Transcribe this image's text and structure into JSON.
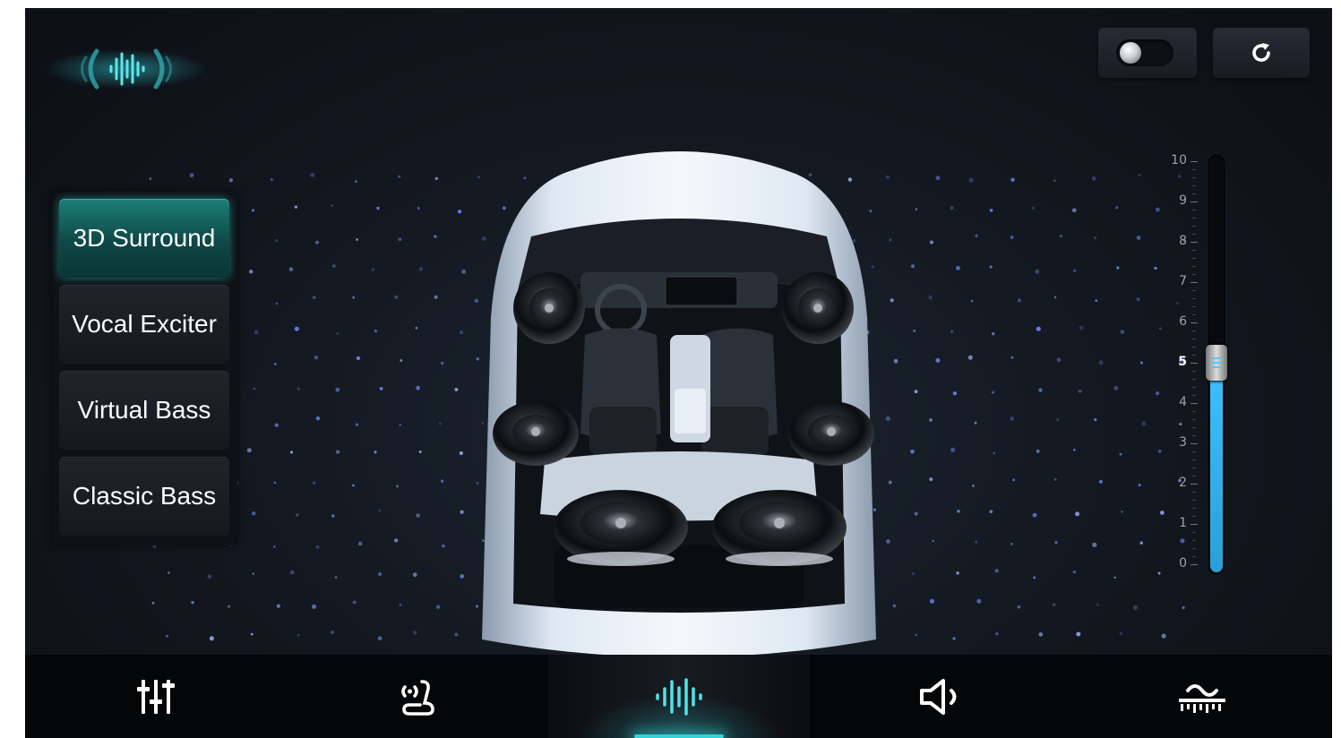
{
  "header": {
    "logo_icon": "sound-wave-logo-icon",
    "toggle": {
      "icon": "toggle-switch-icon",
      "state": "off"
    },
    "reset": {
      "icon": "refresh-icon"
    }
  },
  "sound_modes": {
    "items": [
      {
        "label": "3D Surround",
        "active": true
      },
      {
        "label": "Vocal Exciter",
        "active": false
      },
      {
        "label": "Virtual Bass",
        "active": false
      },
      {
        "label": "Classic Bass",
        "active": false
      }
    ]
  },
  "level_slider": {
    "ticks": [
      "10",
      "9",
      "8",
      "7",
      "6",
      "5",
      "4",
      "3",
      "2",
      "1",
      "0"
    ],
    "min": 0,
    "max": 10,
    "value": 5
  },
  "colors": {
    "accent_teal": "#2fd3d8",
    "slider_blue": "#3fc4ff",
    "active_button": "#1d7f78",
    "background": "#141a22"
  },
  "bottom_nav": {
    "items": [
      {
        "icon": "equalizer-sliders-icon",
        "active": false
      },
      {
        "icon": "seat-sound-icon",
        "active": false
      },
      {
        "icon": "sound-wave-icon",
        "active": true
      },
      {
        "icon": "volume-speaker-icon",
        "active": false
      },
      {
        "icon": "sound-field-icon",
        "active": false
      }
    ]
  }
}
